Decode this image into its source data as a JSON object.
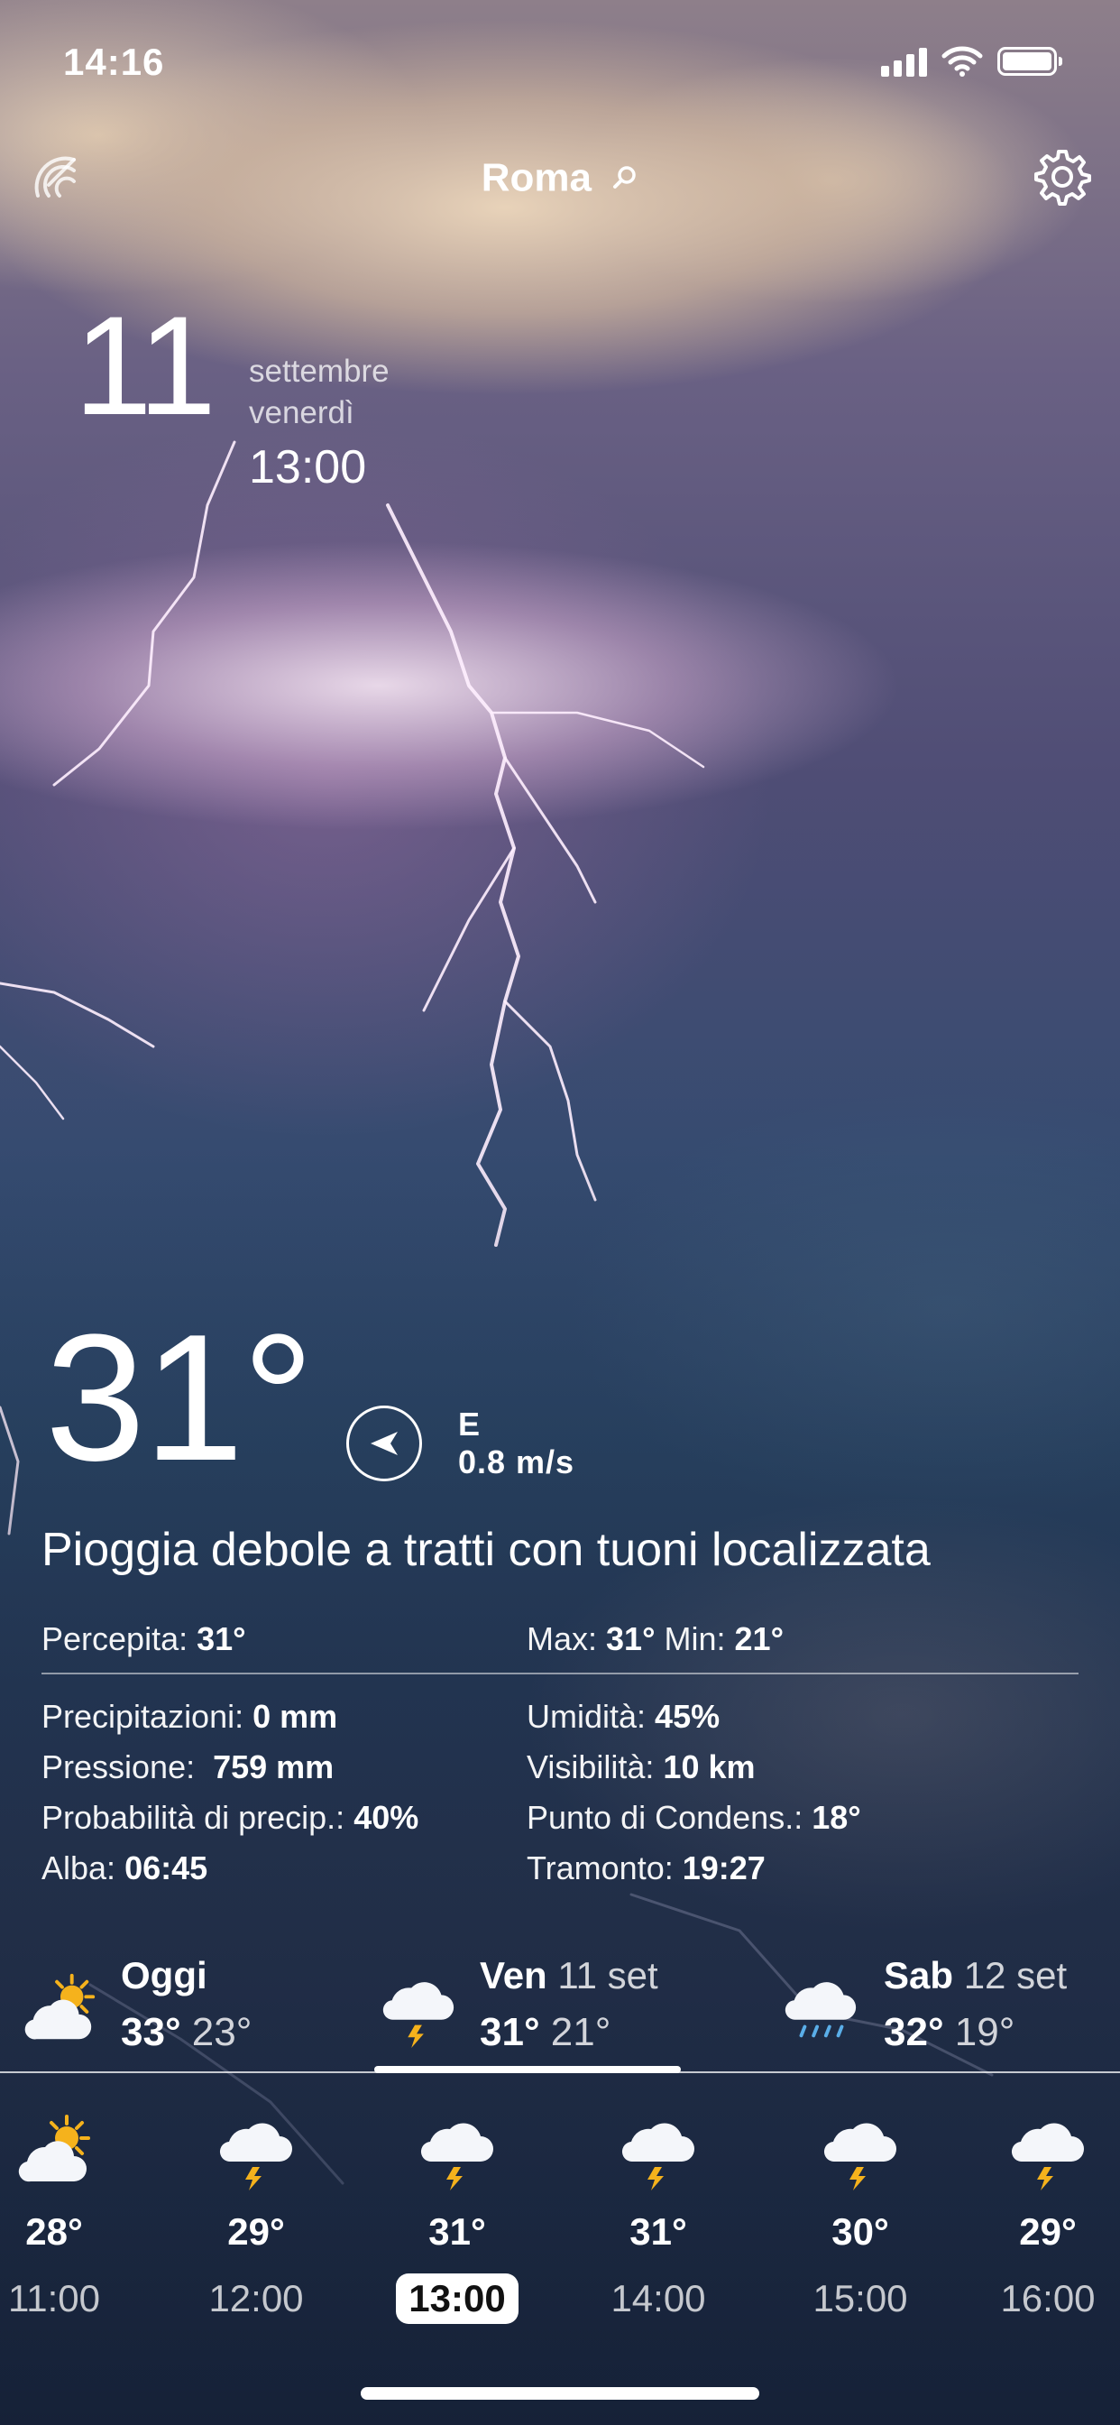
{
  "status_bar": {
    "time": "14:16"
  },
  "header": {
    "city": "Roma"
  },
  "date": {
    "day": "11",
    "month": "settembre",
    "weekday": "venerdì",
    "hour": "13:00"
  },
  "current": {
    "temp": "31°",
    "wind_dir": "E",
    "wind_speed": "0.8 m/s",
    "description": "Pioggia debole a tratti con tuoni localizzata"
  },
  "details": {
    "percepita": {
      "label": "Percepita:",
      "value": "31°"
    },
    "max": {
      "label": "Max:",
      "value": "31°"
    },
    "min": {
      "label": "Min:",
      "value": "21°"
    },
    "precipitazioni": {
      "label": "Precipitazioni:",
      "value": "0 mm"
    },
    "umidita": {
      "label": "Umidità:",
      "value": "45%"
    },
    "pressione": {
      "label": "Pressione:",
      "value": "759 mm"
    },
    "visibilita": {
      "label": "Visibilità:",
      "value": "10 km"
    },
    "probabilita": {
      "label": "Probabilità di precip.:",
      "value": "40%"
    },
    "punto_condens": {
      "label": "Punto di Condens.:",
      "value": "18°"
    },
    "alba": {
      "label": "Alba:",
      "value": "06:45"
    },
    "tramonto": {
      "label": "Tramonto:",
      "value": "19:27"
    }
  },
  "days": [
    {
      "name": "Oggi",
      "date": "",
      "max": "33°",
      "min": "23°",
      "icon": "partly-sunny-icon"
    },
    {
      "name": "Ven",
      "date": "11 set",
      "max": "31°",
      "min": "21°",
      "icon": "thunder-cloud-icon",
      "selected": true
    },
    {
      "name": "Sab",
      "date": "12 set",
      "max": "32°",
      "min": "19°",
      "icon": "rain-cloud-icon"
    }
  ],
  "hourly": [
    {
      "temp": "28°",
      "time": "11:00",
      "icon": "partly-sunny-icon"
    },
    {
      "temp": "29°",
      "time": "12:00",
      "icon": "thunder-cloud-icon"
    },
    {
      "temp": "31°",
      "time": "13:00",
      "icon": "thunder-cloud-icon",
      "selected": true
    },
    {
      "temp": "31°",
      "time": "14:00",
      "icon": "thunder-cloud-icon"
    },
    {
      "temp": "30°",
      "time": "15:00",
      "icon": "thunder-cloud-icon"
    },
    {
      "temp": "29°",
      "time": "16:00",
      "icon": "thunder-cloud-icon"
    }
  ]
}
